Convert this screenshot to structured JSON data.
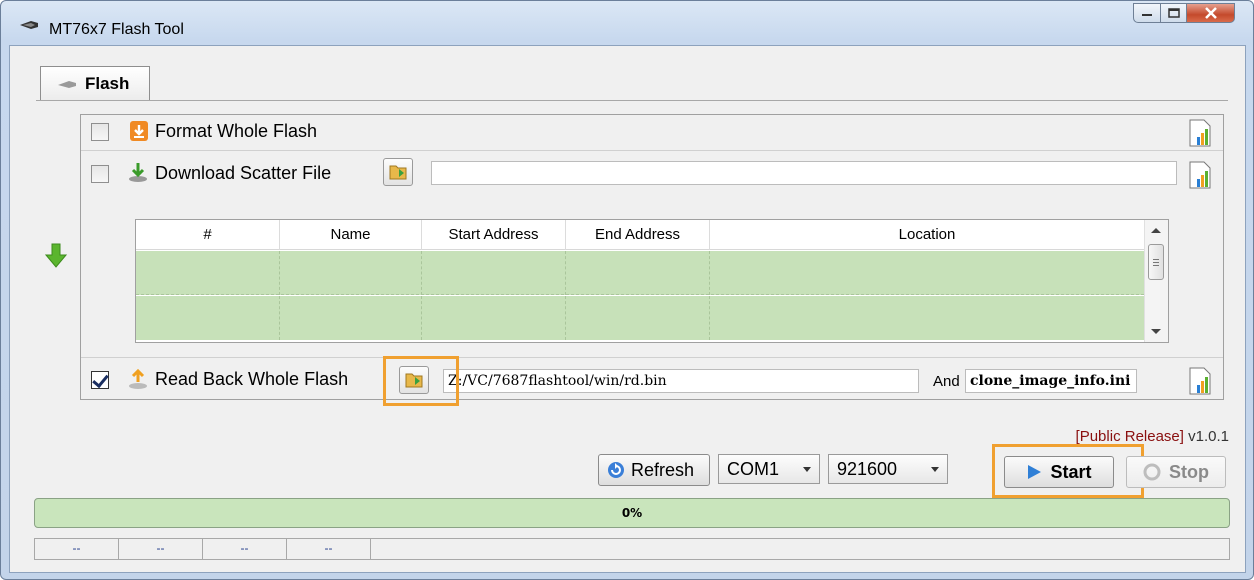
{
  "window": {
    "title": "MT76x7 Flash Tool"
  },
  "tabs": [
    {
      "label": "Flash",
      "active": true
    }
  ],
  "operations": {
    "format": {
      "label": "Format Whole Flash",
      "checked": false
    },
    "download": {
      "label": "Download Scatter File",
      "checked": false,
      "path": ""
    },
    "readback": {
      "label": "Read Back Whole Flash",
      "checked": true,
      "path": "Z:/VC/7687flashtool/win/rd.bin",
      "and_label": "And",
      "ini_file": "clone_image_info.ini"
    }
  },
  "table": {
    "columns": [
      "#",
      "Name",
      "Start Address",
      "End Address",
      "Location"
    ],
    "rows": [
      [
        "",
        "",
        "",
        "",
        ""
      ],
      [
        "",
        "",
        "",
        "",
        ""
      ]
    ]
  },
  "version": {
    "bracket": "[Public Release]",
    "number": "v1.0.1"
  },
  "controls": {
    "refresh_label": "Refresh",
    "port": "COM1",
    "baud": "921600",
    "start_label": "Start",
    "stop_label": "Stop"
  },
  "progress": {
    "text": "0%",
    "percent": 0
  },
  "statusbar": [
    "--",
    "--",
    "--",
    "--",
    ""
  ],
  "colors": {
    "highlight": "#f0a030",
    "row_green": "#c7e1b9",
    "progress_green": "#c9e5bc",
    "version_red": "#8a1010"
  }
}
